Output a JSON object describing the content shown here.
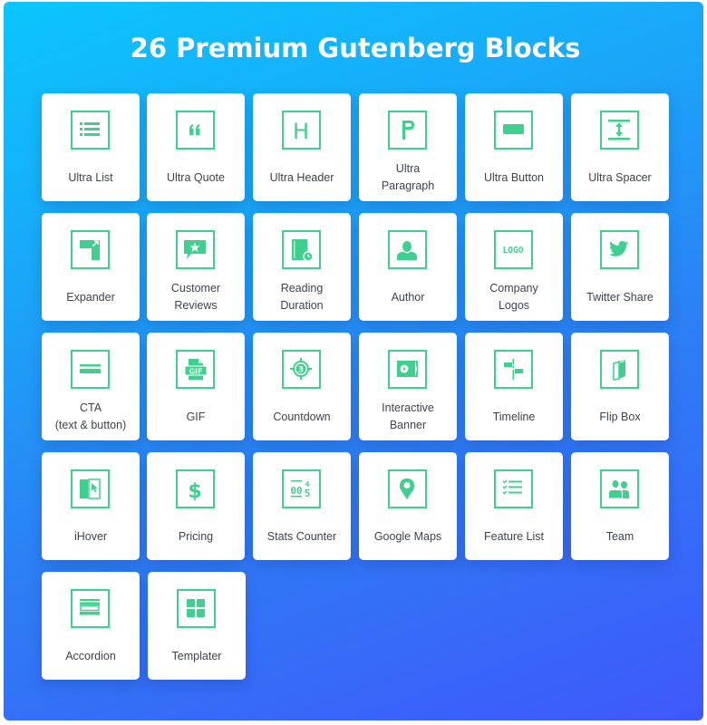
{
  "title": "26 Premium Gutenberg Blocks",
  "colors": {
    "accent": "#3fcf8e",
    "gradient_start": "#0bc6fd",
    "gradient_end": "#3f58fb",
    "card_bg": "#ffffff",
    "label_text": "#3d4350"
  },
  "blocks": [
    {
      "label": "Ultra List",
      "icon": "list-icon"
    },
    {
      "label": "Ultra Quote",
      "icon": "quote-icon"
    },
    {
      "label": "Ultra Header",
      "icon": "header-h-icon"
    },
    {
      "label": "Ultra Paragraph",
      "icon": "paragraph-p-icon"
    },
    {
      "label": "Ultra Button",
      "icon": "button-icon"
    },
    {
      "label": "Ultra Spacer",
      "icon": "spacer-icon"
    },
    {
      "label": "Expander",
      "icon": "expander-icon"
    },
    {
      "label": "Customer Reviews",
      "icon": "review-star-icon"
    },
    {
      "label": "Reading Duration",
      "icon": "book-clock-icon"
    },
    {
      "label": "Author",
      "icon": "user-icon"
    },
    {
      "label": "Company Logos",
      "icon": "logo-icon"
    },
    {
      "label": "Twitter Share",
      "icon": "twitter-icon"
    },
    {
      "label": "CTA (text & button)",
      "icon": "cta-icon"
    },
    {
      "label": "GIF",
      "icon": "gif-file-icon"
    },
    {
      "label": "Countdown",
      "icon": "countdown-icon"
    },
    {
      "label": "Interactive Banner",
      "icon": "banner-play-icon"
    },
    {
      "label": "Timeline",
      "icon": "timeline-icon"
    },
    {
      "label": "Flip Box",
      "icon": "flip-box-icon"
    },
    {
      "label": "iHover",
      "icon": "hover-cursor-icon"
    },
    {
      "label": "Pricing",
      "icon": "dollar-icon"
    },
    {
      "label": "Stats Counter",
      "icon": "counter-icon"
    },
    {
      "label": "Google Maps",
      "icon": "map-pin-icon"
    },
    {
      "label": "Feature List",
      "icon": "checklist-icon"
    },
    {
      "label": "Team",
      "icon": "team-icon"
    },
    {
      "label": "Accordion",
      "icon": "accordion-icon"
    },
    {
      "label": "Templater",
      "icon": "grid-icon"
    }
  ],
  "label_lines": {
    "3": [
      "Ultra",
      "Paragraph"
    ],
    "7": [
      "Customer",
      "Reviews"
    ],
    "8": [
      "Reading",
      "Duration"
    ],
    "10": [
      "Company",
      "Logos"
    ],
    "12": [
      "CTA",
      "(text & button)"
    ],
    "15": [
      "Interactive",
      "Banner"
    ]
  },
  "icon_texts": {
    "logo": "LOGO",
    "gif": "GIF",
    "countdown": "3",
    "counter": "00",
    "counter_top": "4",
    "counter_bottom": "5",
    "paragraph": "P",
    "header": "H",
    "dollar": "$"
  }
}
